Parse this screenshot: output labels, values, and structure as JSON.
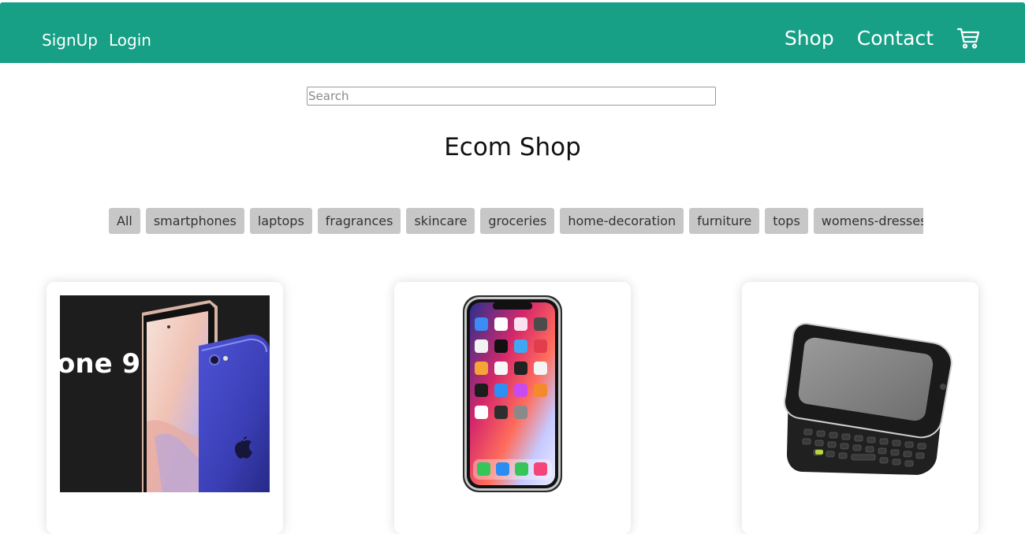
{
  "nav": {
    "signup": "SignUp",
    "login": "Login",
    "shop": "Shop",
    "contact": "Contact",
    "cart_icon": "shopping-cart-icon",
    "bg_color": "#17a085"
  },
  "search": {
    "placeholder": "Search"
  },
  "title": "Ecom Shop",
  "categories": [
    "All",
    "smartphones",
    "laptops",
    "fragrances",
    "skincare",
    "groceries",
    "home-decoration",
    "furniture",
    "tops",
    "womens-dresses"
  ],
  "products": [
    {
      "image_text": "one 9",
      "image": "iphone-9-photo"
    },
    {
      "image": "iphone-x-photo"
    },
    {
      "image": "slider-keyboard-phone-photo"
    }
  ]
}
